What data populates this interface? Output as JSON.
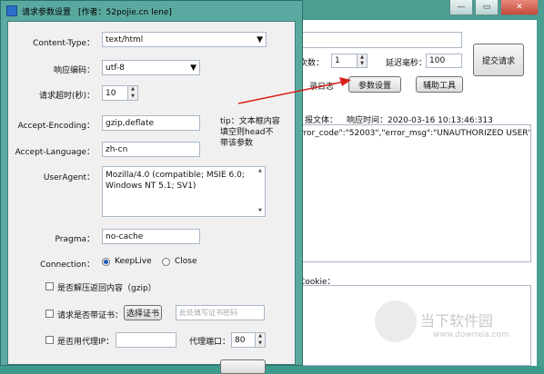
{
  "dialog": {
    "title": "请求参数设置",
    "author": "[作者：52pojie.cn lene]",
    "content_type": {
      "label": "Content-Type：",
      "value": "text/html"
    },
    "encoding": {
      "label": "响应编码：",
      "value": "utf-8"
    },
    "timeout": {
      "label": "请求超时(秒)：",
      "value": "10"
    },
    "accept_encoding": {
      "label": "Accept-Encoding：",
      "value": "gzip,deflate"
    },
    "accept_language": {
      "label": "Accept-Language：",
      "value": "zh-cn"
    },
    "tip": "tip：文本框内容填空则head不带该参数",
    "user_agent": {
      "label": "UserAgent：",
      "value": "Mozilla/4.0 (compatible; MSIE 6.0; Windows NT 5.1; SV1)"
    },
    "pragma": {
      "label": "Pragma：",
      "value": "no-cache"
    },
    "connection": {
      "label": "Connection：",
      "option1": "KeepLive",
      "option2": "Close",
      "selected": "KeepLive"
    },
    "gzip_check": "是否解压返回内容（gzip）",
    "cert_check": "请求是否带证书：",
    "cert_button": "选择证书",
    "cert_placeholder": "此处填写证书密码",
    "proxy_check": "是否用代理IP：",
    "proxy_port_label": "代理端口：",
    "proxy_port": "80"
  },
  "main_window": {
    "count_label": "次数：",
    "count_value": "1",
    "delay_label": "延迟毫秒：",
    "delay_value": "100",
    "submit_button": "提交请求",
    "log_label": "录日志",
    "params_button": "参数设置",
    "tools_button": "辅助工具",
    "response_label": "报文体：",
    "response_time": "响应时间：2020-03-16 10:13:46:313",
    "response_body": "rror_code\":\"52003\",\"error_msg\":\"UNAUTHORIZED USER\"}",
    "cookie_label": "Cookie："
  },
  "watermark": {
    "name": "当下软件园",
    "url": "www.downxia.com"
  },
  "colors": {
    "window_frame": "#5aa9a0",
    "arrow": "#d9221c",
    "accent": "#1a5bb8"
  }
}
